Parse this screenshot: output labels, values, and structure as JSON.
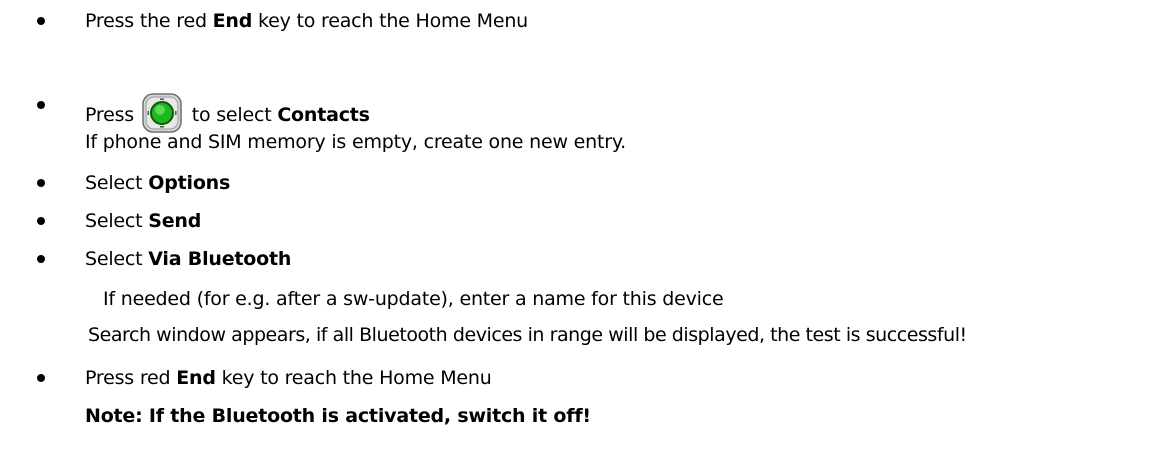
{
  "steps": [
    {
      "pre": "Press the red ",
      "bold": "End",
      "post": " key to reach the Home Menu"
    },
    {
      "pre": "Press ",
      "bold": "Contacts",
      "mid": " to select ",
      "icon": "green-navigation-key-icon"
    },
    {
      "text": "If phone and SIM memory is empty, create one new entry."
    },
    {
      "pre": "Select ",
      "bold": "Options"
    },
    {
      "pre": "Select ",
      "bold": "Send"
    },
    {
      "pre": "Select ",
      "bold": "Via Bluetooth"
    },
    {
      "text": "If needed (for e.g. after a sw-update), enter a name for this device"
    },
    {
      "text": "Search window appears, if all Bluetooth devices in range will be displayed, the test is successful!"
    },
    {
      "pre": "Press red ",
      "bold": "End",
      "post": " key to reach the Home Menu"
    },
    {
      "note": "Note: If the Bluetooth is activated, switch it off!"
    }
  ],
  "colors": {
    "text": "#000000",
    "key_green": "#22cc22",
    "key_gray": "#c8c8c8"
  }
}
